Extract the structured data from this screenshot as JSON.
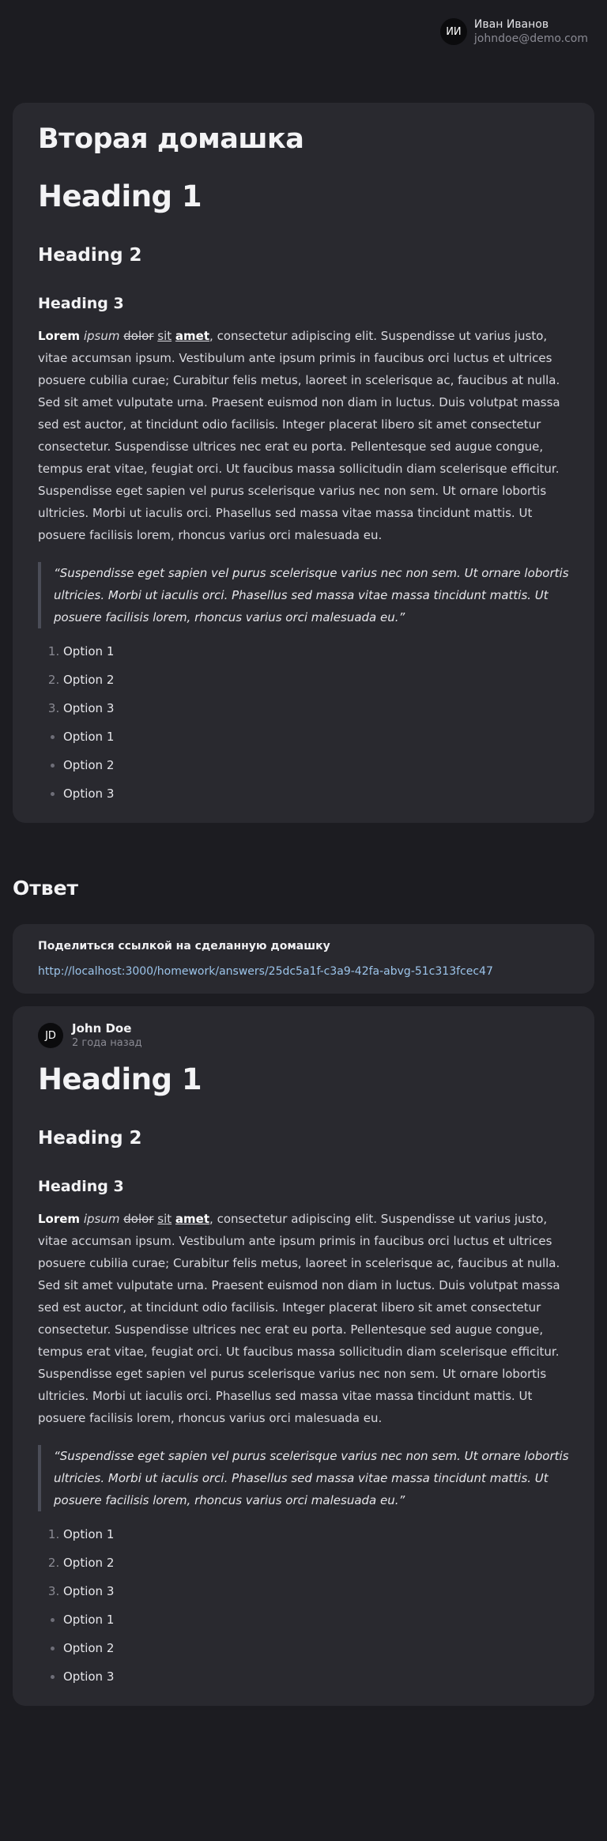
{
  "header": {
    "user": {
      "initials": "ИИ",
      "name": "Иван Иванов",
      "email": "johndoe@demo.com"
    }
  },
  "homework": {
    "title": "Вторая домашка",
    "h1": "Heading 1",
    "h2": "Heading 2",
    "h3": "Heading 3",
    "p_bold": "Lorem",
    "p_italic": "ipsum",
    "p_strike": "dolor",
    "p_underline": "sit",
    "p_bold_underline": "amet",
    "p_rest": ", consectetur adipiscing elit. Suspendisse ut varius justo, vitae accumsan ipsum. Vestibulum ante ipsum primis in faucibus orci luctus et ultrices posuere cubilia curae; Curabitur felis metus, laoreet in scelerisque ac, faucibus at nulla. Sed sit amet vulputate urna. Praesent euismod non diam in luctus. Duis volutpat massa sed est auctor, at tincidunt odio facilisis. Integer placerat libero sit amet consectetur consectetur. Suspendisse ultrices nec erat eu porta. Pellentesque sed augue congue, tempus erat vitae, feugiat orci. Ut faucibus massa sollicitudin diam scelerisque efficitur. Suspendisse eget sapien vel purus scelerisque varius nec non sem. Ut ornare lobortis ultricies. Morbi ut iaculis orci. Phasellus sed massa vitae massa tincidunt mattis. Ut posuere facilisis lorem, rhoncus varius orci malesuada eu.",
    "quote": "“Suspendisse eget sapien vel purus scelerisque varius nec non sem. Ut ornare lobortis ultricies. Morbi ut iaculis orci. Phasellus sed massa vitae massa tincidunt mattis. Ut posuere facilisis lorem, rhoncus varius orci malesuada eu.”",
    "ordered": [
      "Option 1",
      "Option 2",
      "Option 3"
    ],
    "bullets": [
      "Option 1",
      "Option 2",
      "Option 3"
    ]
  },
  "answer_section": {
    "title": "Ответ",
    "share_title": "Поделиться ссылкой на сделанную домашку",
    "share_link": "http://localhost:3000/homework/answers/25dc5a1f-c3a9-42fa-abvg-51c313fcec47"
  },
  "answer": {
    "author_initials": "JD",
    "author_name": "John Doe",
    "time": "2 года назад",
    "h1": "Heading 1",
    "h2": "Heading 2",
    "h3": "Heading 3",
    "p_bold": "Lorem",
    "p_italic": "ipsum",
    "p_strike": "dolor",
    "p_underline": "sit",
    "p_bold_underline": "amet",
    "p_rest": ", consectetur adipiscing elit. Suspendisse ut varius justo, vitae accumsan ipsum. Vestibulum ante ipsum primis in faucibus orci luctus et ultrices posuere cubilia curae; Curabitur felis metus, laoreet in scelerisque ac, faucibus at nulla. Sed sit amet vulputate urna. Praesent euismod non diam in luctus. Duis volutpat massa sed est auctor, at tincidunt odio facilisis. Integer placerat libero sit amet consectetur consectetur. Suspendisse ultrices nec erat eu porta. Pellentesque sed augue congue, tempus erat vitae, feugiat orci. Ut faucibus massa sollicitudin diam scelerisque efficitur. Suspendisse eget sapien vel purus scelerisque varius nec non sem. Ut ornare lobortis ultricies. Morbi ut iaculis orci. Phasellus sed massa vitae massa tincidunt mattis. Ut posuere facilisis lorem, rhoncus varius orci malesuada eu.",
    "quote": "“Suspendisse eget sapien vel purus scelerisque varius nec non sem. Ut ornare lobortis ultricies. Morbi ut iaculis orci. Phasellus sed massa vitae massa tincidunt mattis. Ut posuere facilisis lorem, rhoncus varius orci malesuada eu.”",
    "ordered": [
      "Option 1",
      "Option 2",
      "Option 3"
    ],
    "bullets": [
      "Option 1",
      "Option 2",
      "Option 3"
    ]
  },
  "colors": {
    "background": "#1c1c21",
    "card": "#29292f",
    "link": "#9cc4ea",
    "quote_border": "#4b4d58"
  }
}
